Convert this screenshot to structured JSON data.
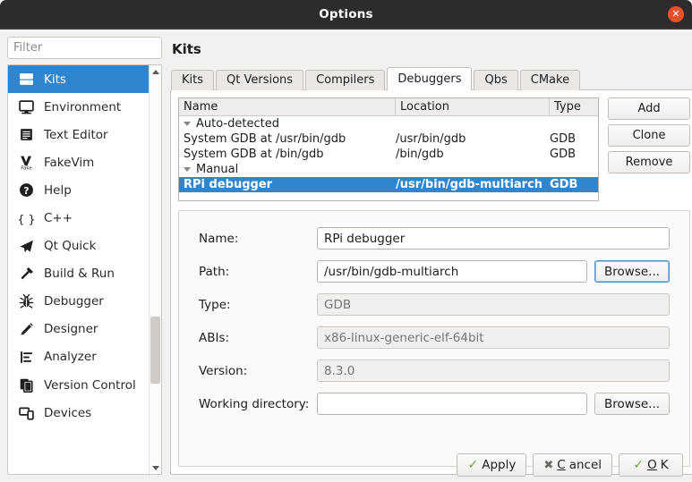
{
  "window": {
    "title": "Options",
    "close_label": "✕",
    "accent_blue": "#2f86ce",
    "close_orange": "#e8502a"
  },
  "sidebar": {
    "filter_placeholder": "Filter",
    "filter_value": "",
    "items": [
      {
        "label": "Kits",
        "icon": "kits-icon",
        "selected": true
      },
      {
        "label": "Environment",
        "icon": "monitor-icon",
        "selected": false
      },
      {
        "label": "Text Editor",
        "icon": "text-lines-icon",
        "selected": false
      },
      {
        "label": "FakeVim",
        "icon": "fakevim-icon",
        "selected": false
      },
      {
        "label": "Help",
        "icon": "question-circle-icon",
        "selected": false
      },
      {
        "label": "C++",
        "icon": "braces-icon",
        "selected": false
      },
      {
        "label": "Qt Quick",
        "icon": "paper-plane-icon",
        "selected": false
      },
      {
        "label": "Build & Run",
        "icon": "hammer-icon",
        "selected": false
      },
      {
        "label": "Debugger",
        "icon": "bug-icon",
        "selected": false
      },
      {
        "label": "Designer",
        "icon": "pencil-icon",
        "selected": false
      },
      {
        "label": "Analyzer",
        "icon": "analyzer-icon",
        "selected": false
      },
      {
        "label": "Version Control",
        "icon": "copy-pages-icon",
        "selected": false
      },
      {
        "label": "Devices",
        "icon": "devices-icon",
        "selected": false
      }
    ]
  },
  "page": {
    "title": "Kits",
    "tabs": [
      {
        "label": "Kits",
        "active": false
      },
      {
        "label": "Qt Versions",
        "active": false
      },
      {
        "label": "Compilers",
        "active": false
      },
      {
        "label": "Debuggers",
        "active": true
      },
      {
        "label": "Qbs",
        "active": false
      },
      {
        "label": "CMake",
        "active": false
      }
    ]
  },
  "tree": {
    "columns": [
      "Name",
      "Location",
      "Type"
    ],
    "rows": [
      {
        "name": "Auto-detected",
        "location": "",
        "type": "",
        "level": 0,
        "group": true,
        "selected": false
      },
      {
        "name": "System GDB at /usr/bin/gdb",
        "location": "/usr/bin/gdb",
        "type": "GDB",
        "level": 1,
        "group": false,
        "selected": false
      },
      {
        "name": "System GDB at /bin/gdb",
        "location": "/bin/gdb",
        "type": "GDB",
        "level": 1,
        "group": false,
        "selected": false
      },
      {
        "name": "Manual",
        "location": "",
        "type": "",
        "level": 0,
        "group": true,
        "selected": false
      },
      {
        "name": "RPi debugger",
        "location": "/usr/bin/gdb-multiarch",
        "type": "GDB",
        "level": 1,
        "group": false,
        "selected": true
      }
    ]
  },
  "tree_buttons": {
    "add": "Add",
    "clone": "Clone",
    "remove": "Remove"
  },
  "form": {
    "name": {
      "label": "Name:",
      "value": "RPi debugger",
      "placeholder": "",
      "disabled": false
    },
    "path": {
      "label": "Path:",
      "value": "/usr/bin/gdb-multiarch",
      "placeholder": "",
      "disabled": false,
      "browse": "Browse..."
    },
    "type": {
      "label": "Type:",
      "value": "",
      "placeholder": "GDB",
      "disabled": true
    },
    "abis": {
      "label": "ABIs:",
      "value": "",
      "placeholder": "x86-linux-generic-elf-64bit",
      "disabled": true
    },
    "version": {
      "label": "Version:",
      "value": "",
      "placeholder": "8.3.0",
      "disabled": true
    },
    "workdir": {
      "label": "Working directory:",
      "value": "",
      "placeholder": "",
      "disabled": false,
      "browse": "Browse..."
    }
  },
  "footer": {
    "apply": {
      "pre": "Apply",
      "mnemonic": "",
      "post": "",
      "icon": "check-icon"
    },
    "cancel": {
      "pre": "",
      "mnemonic": "C",
      "post": "ancel",
      "icon": "cross-icon"
    },
    "ok": {
      "pre": "",
      "mnemonic": "O",
      "post": "K",
      "icon": "check-icon"
    }
  }
}
